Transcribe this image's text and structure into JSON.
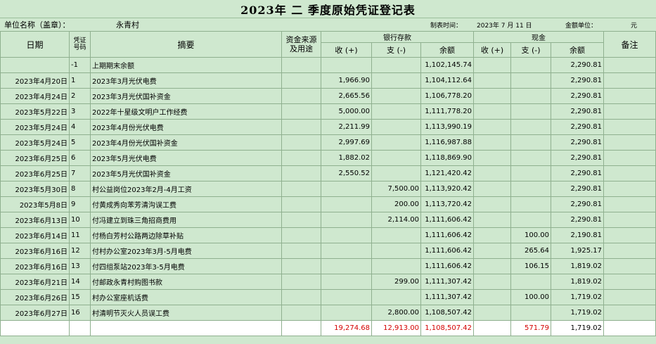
{
  "title": "2023年  二  季度原始凭证登记表",
  "info": {
    "unit_label": "单位名称（盖章）：",
    "unit_value": "永青村",
    "made_time_label": "制表时间：",
    "made_time_value": "2023年 7   月  11  日",
    "currency_label": "金额单位：",
    "currency_value": "元"
  },
  "headers": {
    "date": "日期",
    "voucher_no": "凭证号码",
    "summary": "摘要",
    "fund_source": "资金来源及用途",
    "bank": "银行存款",
    "cash": "现金",
    "income": "收 (+)",
    "expense": "支 (-)",
    "balance": "余额",
    "remarks": "备注"
  },
  "rows": [
    {
      "date": "",
      "no": "-1",
      "summary": "上期期末余额",
      "fund": "",
      "b_in": "",
      "b_out": "",
      "b_bal": "1,102,145.74",
      "c_in": "",
      "c_out": "",
      "c_bal": "2,290.81",
      "remark": ""
    },
    {
      "date": "2023年4月20日",
      "no": "1",
      "summary": "  2023年3月光伏电费",
      "fund": "",
      "b_in": "1,966.90",
      "b_out": "",
      "b_bal": "1,104,112.64",
      "c_in": "",
      "c_out": "",
      "c_bal": "2,290.81",
      "remark": ""
    },
    {
      "date": "2023年4月24日",
      "no": "2",
      "summary": "  2023年3月光伏国补资金",
      "fund": "",
      "b_in": "2,665.56",
      "b_out": "",
      "b_bal": "1,106,778.20",
      "c_in": "",
      "c_out": "",
      "c_bal": "2,290.81",
      "remark": ""
    },
    {
      "date": "2023年5月22日",
      "no": "3",
      "summary": "  2022年十星级文明户工作经费",
      "fund": "",
      "b_in": "5,000.00",
      "b_out": "",
      "b_bal": "1,111,778.20",
      "c_in": "",
      "c_out": "",
      "c_bal": "2,290.81",
      "remark": ""
    },
    {
      "date": "2023年5月24日",
      "no": "4",
      "summary": "  2023年4月份光伏电费",
      "fund": "",
      "b_in": "2,211.99",
      "b_out": "",
      "b_bal": "1,113,990.19",
      "c_in": "",
      "c_out": "",
      "c_bal": "2,290.81",
      "remark": ""
    },
    {
      "date": "2023年5月24日",
      "no": "5",
      "summary": "  2023年4月份光伏国补资金",
      "fund": "",
      "b_in": "2,997.69",
      "b_out": "",
      "b_bal": "1,116,987.88",
      "c_in": "",
      "c_out": "",
      "c_bal": "2,290.81",
      "remark": ""
    },
    {
      "date": "2023年6月25日",
      "no": "6",
      "summary": "  2023年5月光伏电费",
      "fund": "",
      "b_in": "1,882.02",
      "b_out": "",
      "b_bal": "1,118,869.90",
      "c_in": "",
      "c_out": "",
      "c_bal": "2,290.81",
      "remark": ""
    },
    {
      "date": "2023年6月25日",
      "no": "7",
      "summary": "2023年5月光伏国补资金",
      "fund": "",
      "b_in": "2,550.52",
      "b_out": "",
      "b_bal": "1,121,420.42",
      "c_in": "",
      "c_out": "",
      "c_bal": "2,290.81",
      "remark": ""
    },
    {
      "date": "2023年5月30日",
      "no": "8",
      "summary": "村公益岗位2023年2月-4月工资",
      "fund": "",
      "b_in": "",
      "b_out": "7,500.00",
      "b_bal": "1,113,920.42",
      "c_in": "",
      "c_out": "",
      "c_bal": "2,290.81",
      "remark": ""
    },
    {
      "date": "2023年5月8日",
      "no": "9",
      "summary": "付黄成秀向苯芳清沟误工费",
      "fund": "",
      "b_in": "",
      "b_out": "200.00",
      "b_bal": "1,113,720.42",
      "c_in": "",
      "c_out": "",
      "c_bal": "2,290.81",
      "remark": ""
    },
    {
      "date": "2023年6月13日",
      "no": "10",
      "summary": "  付冯建立到珠三角招商费用",
      "fund": "",
      "b_in": "",
      "b_out": "2,114.00",
      "b_bal": "1,111,606.42",
      "c_in": "",
      "c_out": "",
      "c_bal": "2,290.81",
      "remark": ""
    },
    {
      "date": "2023年6月14日",
      "no": "11",
      "summary": "付杨白芳村公路两边除草补贴",
      "fund": "",
      "b_in": "",
      "b_out": "",
      "b_bal": "1,111,606.42",
      "c_in": "",
      "c_out": "100.00",
      "c_bal": "2,190.81",
      "remark": ""
    },
    {
      "date": "2023年6月16日",
      "no": "12",
      "summary": "付村办公室2023年3月-5月电费",
      "fund": "",
      "b_in": "",
      "b_out": "",
      "b_bal": "1,111,606.42",
      "c_in": "",
      "c_out": "265.64",
      "c_bal": "1,925.17",
      "remark": ""
    },
    {
      "date": "2023年6月16日",
      "no": "13",
      "summary": "付四组泵站2023年3-5月电费",
      "fund": "",
      "b_in": "",
      "b_out": "",
      "b_bal": "1,111,606.42",
      "c_in": "",
      "c_out": "106.15",
      "c_bal": "1,819.02",
      "remark": ""
    },
    {
      "date": "2023年6月21日",
      "no": "14",
      "summary": "付邮政永青村购图书款",
      "fund": "",
      "b_in": "",
      "b_out": "299.00",
      "b_bal": "1,111,307.42",
      "c_in": "",
      "c_out": "",
      "c_bal": "1,819.02",
      "remark": ""
    },
    {
      "date": "2023年6月26日",
      "no": "15",
      "summary": "村办公室座机话费",
      "fund": "",
      "b_in": "",
      "b_out": "",
      "b_bal": "1,111,307.42",
      "c_in": "",
      "c_out": "100.00",
      "c_bal": "1,719.02",
      "remark": ""
    },
    {
      "date": "2023年6月27日",
      "no": "16",
      "summary": "村清明节灭火人员误工费",
      "fund": "",
      "b_in": "",
      "b_out": "2,800.00",
      "b_bal": "1,108,507.42",
      "c_in": "",
      "c_out": "",
      "c_bal": "1,719.02",
      "remark": ""
    }
  ],
  "totals": {
    "b_in": "19,274.68",
    "b_out": "12,913.00",
    "b_bal": "1,108,507.42",
    "c_in": "",
    "c_out": "571.79",
    "c_bal": "1,719.02"
  },
  "colors": {
    "sheet_bg": "#cfe8cf",
    "grid": "#8fb08f",
    "total_text": "#d40000"
  }
}
